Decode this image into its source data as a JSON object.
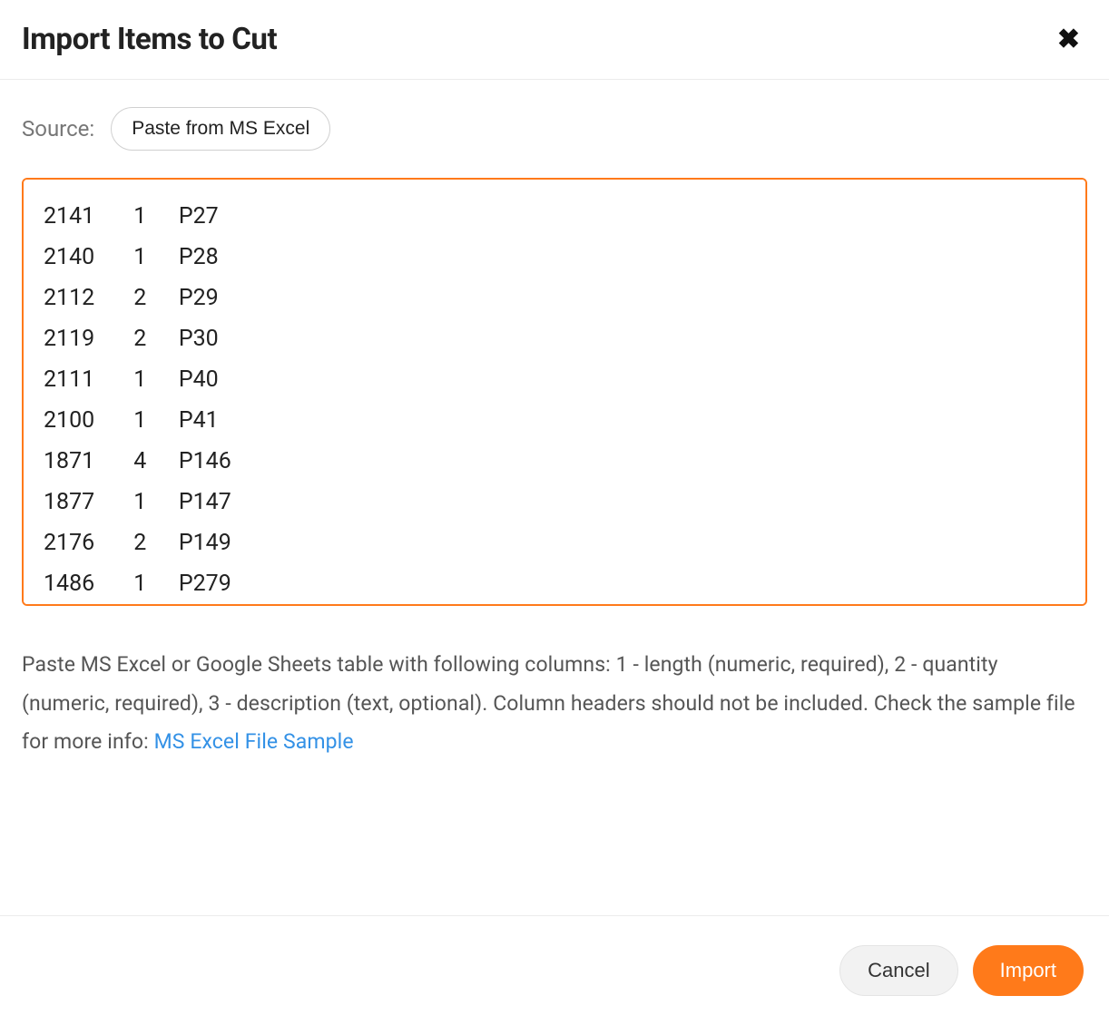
{
  "dialog": {
    "title": "Import Items to Cut"
  },
  "source": {
    "label": "Source:",
    "option": "Paste from MS Excel"
  },
  "paste": {
    "content": "2141\t1\tP27\n2140\t1\tP28\n2112\t2\tP29\n2119\t2\tP30\n2111\t1\tP40\n2100\t1\tP41\n1871\t4\tP146\n1877\t1\tP147\n2176\t2\tP149\n1486\t1\tP279",
    "rows": [
      {
        "length": 2141,
        "quantity": 1,
        "description": "P27"
      },
      {
        "length": 2140,
        "quantity": 1,
        "description": "P28"
      },
      {
        "length": 2112,
        "quantity": 2,
        "description": "P29"
      },
      {
        "length": 2119,
        "quantity": 2,
        "description": "P30"
      },
      {
        "length": 2111,
        "quantity": 1,
        "description": "P40"
      },
      {
        "length": 2100,
        "quantity": 1,
        "description": "P41"
      },
      {
        "length": 1871,
        "quantity": 4,
        "description": "P146"
      },
      {
        "length": 1877,
        "quantity": 1,
        "description": "P147"
      },
      {
        "length": 2176,
        "quantity": 2,
        "description": "P149"
      },
      {
        "length": 1486,
        "quantity": 1,
        "description": "P279"
      }
    ]
  },
  "helper": {
    "text": "Paste MS Excel or Google Sheets table with following columns: 1 - length (numeric, required), 2 - quantity (numeric, required), 3 - description (text, optional). Column headers should not be included. Check the sample file for more info: ",
    "link_text": "MS Excel File Sample"
  },
  "footer": {
    "cancel_label": "Cancel",
    "import_label": "Import"
  }
}
